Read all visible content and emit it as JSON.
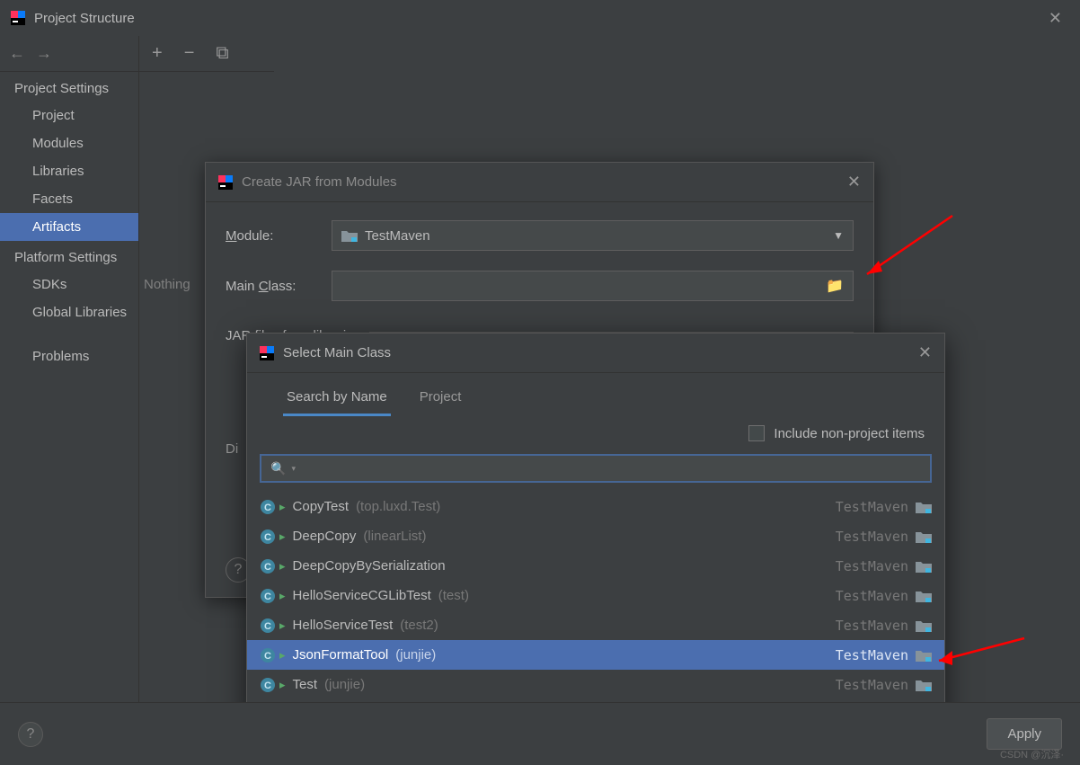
{
  "window": {
    "title": "Project Structure"
  },
  "sidebar": {
    "sections": {
      "project_settings": "Project Settings",
      "platform_settings": "Platform Settings"
    },
    "items": {
      "project": "Project",
      "modules": "Modules",
      "libraries": "Libraries",
      "facets": "Facets",
      "artifacts": "Artifacts",
      "sdks": "SDKs",
      "global_libraries": "Global Libraries",
      "problems": "Problems"
    }
  },
  "content": {
    "nothing": "Nothing"
  },
  "jar_dialog": {
    "title": "Create JAR from Modules",
    "module_label": "Module:",
    "module_value": "TestMaven",
    "mainclass_label": "Main Class:",
    "mainclass_value": "",
    "jar_section": "JAR files from libraries",
    "di": "Di"
  },
  "mainclass_dialog": {
    "title": "Select Main Class",
    "tabs": {
      "search": "Search by Name",
      "project": "Project"
    },
    "include_nonproject": "Include non-project items",
    "search_value": "",
    "results": [
      {
        "name": "CopyTest",
        "pkg": "(top.luxd.Test)",
        "module": "TestMaven"
      },
      {
        "name": "DeepCopy",
        "pkg": "(linearList)",
        "module": "TestMaven"
      },
      {
        "name": "DeepCopyBySerialization",
        "pkg": "",
        "module": "TestMaven"
      },
      {
        "name": "HelloServiceCGLibTest",
        "pkg": "(test)",
        "module": "TestMaven"
      },
      {
        "name": "HelloServiceTest",
        "pkg": "(test2)",
        "module": "TestMaven"
      },
      {
        "name": "JsonFormatTool",
        "pkg": "(junjie)",
        "module": "TestMaven"
      },
      {
        "name": "Test",
        "pkg": "(junjie)",
        "module": "TestMaven"
      }
    ],
    "selected_index": 5
  },
  "footer": {
    "apply": "Apply"
  },
  "watermark": "CSDN @沉泽·"
}
